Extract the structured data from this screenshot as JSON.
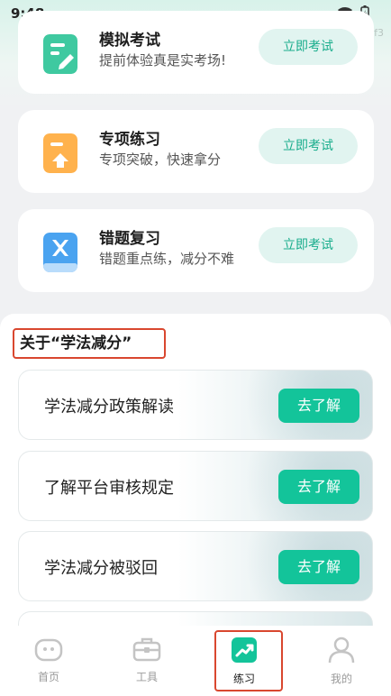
{
  "status_bar": {
    "time": "9:48",
    "hex_label": "c1f5f3"
  },
  "exam_cards": [
    {
      "title": "模拟考试",
      "subtitle": "提前体验真是实考场!",
      "button": "立即考试",
      "icon": "edit-document-icon"
    },
    {
      "title": "专项练习",
      "subtitle": "专项突破，快速拿分",
      "button": "立即考试",
      "icon": "upgrade-document-icon"
    },
    {
      "title": "错题复习",
      "subtitle": "错题重点练，减分不难",
      "button": "立即考试",
      "icon": "wrong-book-icon"
    }
  ],
  "section": {
    "title": "关于“学法减分”"
  },
  "learn_items": [
    {
      "title": "学法减分政策解读",
      "button": "去了解"
    },
    {
      "title": "了解平台审核规定",
      "button": "去了解"
    },
    {
      "title": "学法减分被驳回",
      "button": "去了解"
    }
  ],
  "tabs": [
    {
      "label": "首页",
      "icon": "home-icon"
    },
    {
      "label": "工具",
      "icon": "toolbox-icon"
    },
    {
      "label": "练习",
      "icon": "practice-chart-icon",
      "active": true
    },
    {
      "label": "我的",
      "icon": "user-icon"
    }
  ],
  "colors": {
    "accent": "#13c49a",
    "accent_light": "#e1f4f0",
    "highlight": "#d9472f"
  }
}
